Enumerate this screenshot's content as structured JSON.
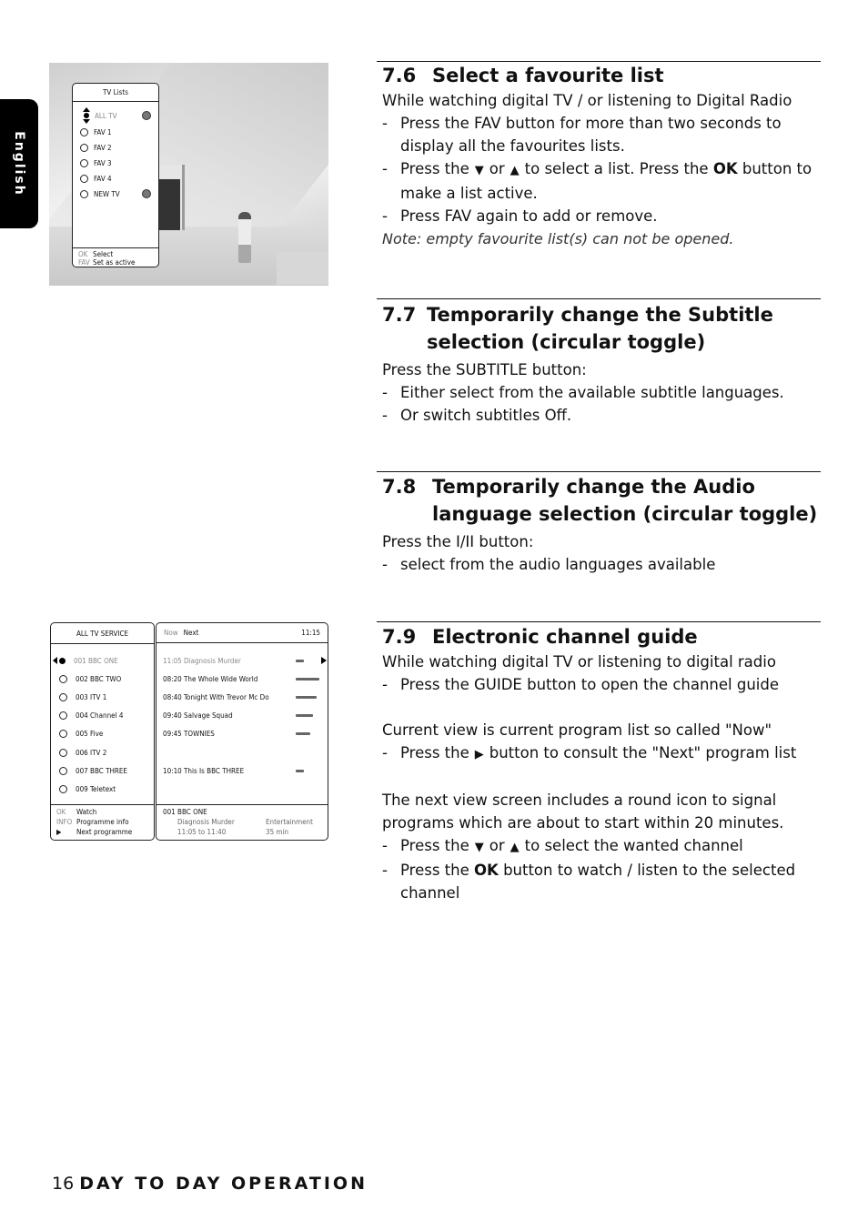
{
  "side_tab": {
    "label": "English"
  },
  "tv_lists_screen": {
    "title": "TV Lists",
    "items": [
      {
        "label": "ALL TV",
        "selected": true,
        "active_icon": true
      },
      {
        "label": "FAV 1",
        "selected": false,
        "active_icon": false
      },
      {
        "label": "FAV 2",
        "selected": false,
        "active_icon": false
      },
      {
        "label": "FAV 3",
        "selected": false,
        "active_icon": false
      },
      {
        "label": "FAV 4",
        "selected": false,
        "active_icon": false
      },
      {
        "label": "NEW TV",
        "selected": false,
        "active_icon": true
      }
    ],
    "footer": [
      {
        "key": "OK",
        "action": "Select"
      },
      {
        "key": "FAV",
        "action": "Set as active"
      }
    ]
  },
  "guide_screen": {
    "channel_list": {
      "title": "ALL TV SERVICE",
      "channels": [
        "001 BBC ONE",
        "002 BBC TWO",
        "003 ITV 1",
        "004 Channel 4",
        "005 Five",
        "006 ITV 2",
        "007 BBC THREE",
        "009 Teletext"
      ],
      "footer": [
        {
          "key": "OK",
          "action": "Watch"
        },
        {
          "key": "INFO",
          "action": "Programme info"
        },
        {
          "key": "▶",
          "action": "Next programme"
        }
      ]
    },
    "programme_list": {
      "tab_now": "Now",
      "tab_next": "Next",
      "clock": "11:15",
      "programmes": [
        {
          "text": "11:05 Diagnosis Murder",
          "progress": 0.35
        },
        {
          "text": "08:20 The Whole Wide World",
          "progress": 1.0
        },
        {
          "text": "08:40 Tonight With Trevor Mc Do",
          "progress": 0.88
        },
        {
          "text": "09:40 Salvage Squad",
          "progress": 0.72
        },
        {
          "text": "09:45 TOWNIES",
          "progress": 0.6
        },
        {
          "text": "",
          "progress": null
        },
        {
          "text": "10:10 This Is BBC THREE",
          "progress": 0.35
        },
        {
          "text": "",
          "progress": null
        }
      ],
      "info": {
        "channel": "001 BBC ONE",
        "title": "Diagnosis Murder",
        "time": "11:05 to 11:40",
        "genre": "Entertainment",
        "duration": "35 min"
      }
    }
  },
  "sections": {
    "s76": {
      "number": "7.6",
      "title": "Select a favourite list",
      "intro": "While watching digital TV / or listening to Digital Radio",
      "b1": "Press the FAV button for more than two seconds to display all the favourites lists.",
      "b2_a": "Press the",
      "b2_down": "▼",
      "b2_or": "or",
      "b2_up": "▲",
      "b2_b": "to select a list.  Press the",
      "b2_ok": "OK",
      "b2_c": "button to make a list active.",
      "b3": "Press FAV again to add or remove.",
      "note": "Note: empty favourite list(s) can not be opened."
    },
    "s77": {
      "number": "7.7",
      "title": "Temporarily change the Subtitle selection (circular toggle)",
      "intro": "Press the SUBTITLE button:",
      "b1": "Either select from the available subtitle languages.",
      "b2": "Or switch subtitles Off."
    },
    "s78": {
      "number": "7.8",
      "title": "Temporarily change the Audio language selection (circular toggle)",
      "intro": "Press the I/II button:",
      "b1": "select from the audio languages available"
    },
    "s79": {
      "number": "7.9",
      "title": "Electronic channel guide",
      "intro": "While watching digital TV or listening to digital radio",
      "b1": "Press the GUIDE button to open the channel guide",
      "p2": "Current view is current program list so called \"Now\"",
      "b2_a": "Press the",
      "b2_sym": "▶",
      "b2_b": "button to consult the \"Next\" program list",
      "p3": "The next view screen includes a round icon to signal programs which are about to start within 20 minutes.",
      "b3_a": "Press the",
      "b3_down": "▼",
      "b3_or": "or",
      "b3_up": "▲",
      "b3_b": "to select the wanted channel",
      "b4_a": "Press the",
      "b4_ok": "OK",
      "b4_b": "button to watch / listen to the selected channel"
    }
  },
  "footer": {
    "page_number": "16",
    "section": "DAY TO DAY OPERATION"
  }
}
